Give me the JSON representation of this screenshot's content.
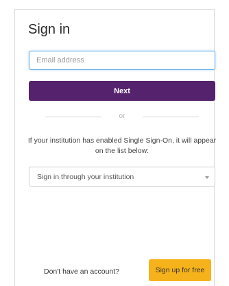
{
  "title": "Sign in",
  "email": {
    "placeholder": "Email address",
    "value": ""
  },
  "next_label": "Next",
  "divider_text": "or",
  "sso_info": "If your institution has enabled Single Sign-On, it will appear on the list below:",
  "institution_select": {
    "selected": "Sign in through your institution"
  },
  "footer": {
    "prompt": "Don't have an account?",
    "signup_label": "Sign up for free"
  },
  "colors": {
    "primary": "#55226e",
    "accent": "#f6b21b",
    "focus": "#66afe9"
  },
  "icons": {
    "dropdown": "chevron-down-icon"
  }
}
